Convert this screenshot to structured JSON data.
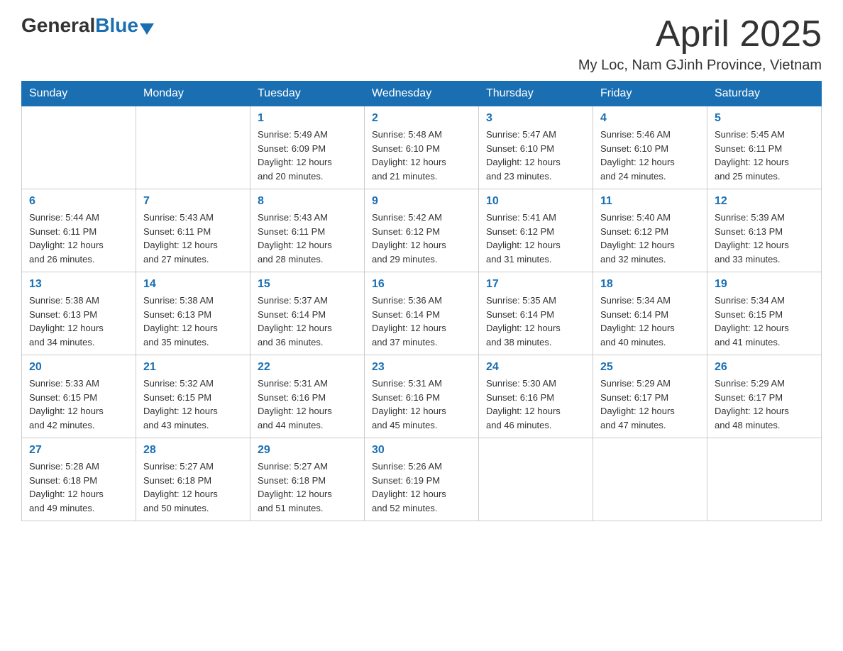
{
  "header": {
    "logo_general": "General",
    "logo_blue": "Blue",
    "title": "April 2025",
    "subtitle": "My Loc, Nam GJinh Province, Vietnam"
  },
  "weekdays": [
    "Sunday",
    "Monday",
    "Tuesday",
    "Wednesday",
    "Thursday",
    "Friday",
    "Saturday"
  ],
  "weeks": [
    [
      {
        "day": "",
        "info": ""
      },
      {
        "day": "",
        "info": ""
      },
      {
        "day": "1",
        "info": "Sunrise: 5:49 AM\nSunset: 6:09 PM\nDaylight: 12 hours\nand 20 minutes."
      },
      {
        "day": "2",
        "info": "Sunrise: 5:48 AM\nSunset: 6:10 PM\nDaylight: 12 hours\nand 21 minutes."
      },
      {
        "day": "3",
        "info": "Sunrise: 5:47 AM\nSunset: 6:10 PM\nDaylight: 12 hours\nand 23 minutes."
      },
      {
        "day": "4",
        "info": "Sunrise: 5:46 AM\nSunset: 6:10 PM\nDaylight: 12 hours\nand 24 minutes."
      },
      {
        "day": "5",
        "info": "Sunrise: 5:45 AM\nSunset: 6:11 PM\nDaylight: 12 hours\nand 25 minutes."
      }
    ],
    [
      {
        "day": "6",
        "info": "Sunrise: 5:44 AM\nSunset: 6:11 PM\nDaylight: 12 hours\nand 26 minutes."
      },
      {
        "day": "7",
        "info": "Sunrise: 5:43 AM\nSunset: 6:11 PM\nDaylight: 12 hours\nand 27 minutes."
      },
      {
        "day": "8",
        "info": "Sunrise: 5:43 AM\nSunset: 6:11 PM\nDaylight: 12 hours\nand 28 minutes."
      },
      {
        "day": "9",
        "info": "Sunrise: 5:42 AM\nSunset: 6:12 PM\nDaylight: 12 hours\nand 29 minutes."
      },
      {
        "day": "10",
        "info": "Sunrise: 5:41 AM\nSunset: 6:12 PM\nDaylight: 12 hours\nand 31 minutes."
      },
      {
        "day": "11",
        "info": "Sunrise: 5:40 AM\nSunset: 6:12 PM\nDaylight: 12 hours\nand 32 minutes."
      },
      {
        "day": "12",
        "info": "Sunrise: 5:39 AM\nSunset: 6:13 PM\nDaylight: 12 hours\nand 33 minutes."
      }
    ],
    [
      {
        "day": "13",
        "info": "Sunrise: 5:38 AM\nSunset: 6:13 PM\nDaylight: 12 hours\nand 34 minutes."
      },
      {
        "day": "14",
        "info": "Sunrise: 5:38 AM\nSunset: 6:13 PM\nDaylight: 12 hours\nand 35 minutes."
      },
      {
        "day": "15",
        "info": "Sunrise: 5:37 AM\nSunset: 6:14 PM\nDaylight: 12 hours\nand 36 minutes."
      },
      {
        "day": "16",
        "info": "Sunrise: 5:36 AM\nSunset: 6:14 PM\nDaylight: 12 hours\nand 37 minutes."
      },
      {
        "day": "17",
        "info": "Sunrise: 5:35 AM\nSunset: 6:14 PM\nDaylight: 12 hours\nand 38 minutes."
      },
      {
        "day": "18",
        "info": "Sunrise: 5:34 AM\nSunset: 6:14 PM\nDaylight: 12 hours\nand 40 minutes."
      },
      {
        "day": "19",
        "info": "Sunrise: 5:34 AM\nSunset: 6:15 PM\nDaylight: 12 hours\nand 41 minutes."
      }
    ],
    [
      {
        "day": "20",
        "info": "Sunrise: 5:33 AM\nSunset: 6:15 PM\nDaylight: 12 hours\nand 42 minutes."
      },
      {
        "day": "21",
        "info": "Sunrise: 5:32 AM\nSunset: 6:15 PM\nDaylight: 12 hours\nand 43 minutes."
      },
      {
        "day": "22",
        "info": "Sunrise: 5:31 AM\nSunset: 6:16 PM\nDaylight: 12 hours\nand 44 minutes."
      },
      {
        "day": "23",
        "info": "Sunrise: 5:31 AM\nSunset: 6:16 PM\nDaylight: 12 hours\nand 45 minutes."
      },
      {
        "day": "24",
        "info": "Sunrise: 5:30 AM\nSunset: 6:16 PM\nDaylight: 12 hours\nand 46 minutes."
      },
      {
        "day": "25",
        "info": "Sunrise: 5:29 AM\nSunset: 6:17 PM\nDaylight: 12 hours\nand 47 minutes."
      },
      {
        "day": "26",
        "info": "Sunrise: 5:29 AM\nSunset: 6:17 PM\nDaylight: 12 hours\nand 48 minutes."
      }
    ],
    [
      {
        "day": "27",
        "info": "Sunrise: 5:28 AM\nSunset: 6:18 PM\nDaylight: 12 hours\nand 49 minutes."
      },
      {
        "day": "28",
        "info": "Sunrise: 5:27 AM\nSunset: 6:18 PM\nDaylight: 12 hours\nand 50 minutes."
      },
      {
        "day": "29",
        "info": "Sunrise: 5:27 AM\nSunset: 6:18 PM\nDaylight: 12 hours\nand 51 minutes."
      },
      {
        "day": "30",
        "info": "Sunrise: 5:26 AM\nSunset: 6:19 PM\nDaylight: 12 hours\nand 52 minutes."
      },
      {
        "day": "",
        "info": ""
      },
      {
        "day": "",
        "info": ""
      },
      {
        "day": "",
        "info": ""
      }
    ]
  ]
}
